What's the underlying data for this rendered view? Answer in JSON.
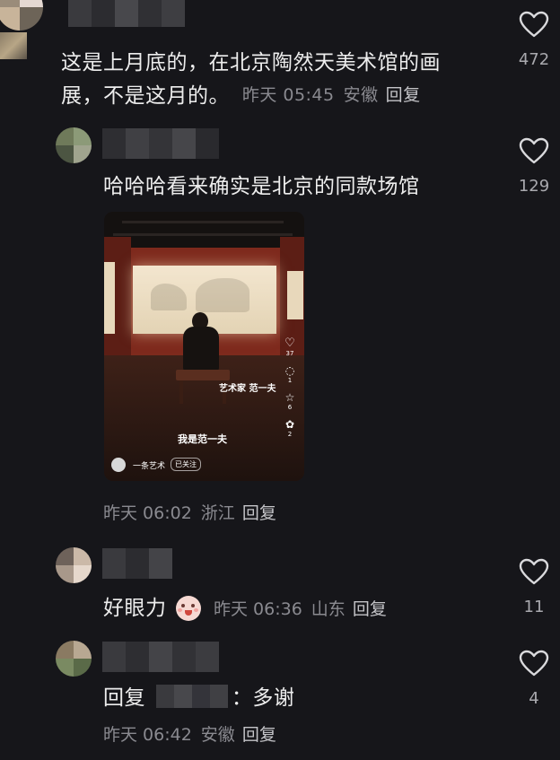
{
  "comments": [
    {
      "text": "这是上月底的，在北京陶然天美术馆的画展，不是这月的。",
      "text_line1": "这是上月底的，在北京陶然天美术馆的画",
      "text_line2": "展，不是这月的。",
      "time": "昨天 05:45",
      "location": "安徽",
      "reply_label": "回复",
      "likes": "472"
    },
    {
      "text": "哈哈哈看来确实是北京的同款场馆",
      "time": "昨天 06:02",
      "location": "浙江",
      "reply_label": "回复",
      "likes": "129",
      "video": {
        "caption_small": "艺术家 范一夫",
        "caption_main": "我是范一夫",
        "author": "一条艺术",
        "follow_status": "已关注",
        "side_counts": [
          "37",
          "1",
          "6",
          "2"
        ]
      }
    },
    {
      "text": "好眼力",
      "emoji": "peach-face-emoji",
      "time": "昨天 06:36",
      "location": "山东",
      "reply_label": "回复",
      "likes": "11"
    },
    {
      "text_prefix": "回复",
      "text_suffix": "：多谢",
      "time": "昨天 06:42",
      "location": "安徽",
      "reply_label": "回复",
      "likes": "4"
    }
  ],
  "colors": {
    "background": "#16161a",
    "text": "#ededed",
    "meta": "#8a8a90",
    "heart": "#d9d9dc"
  }
}
